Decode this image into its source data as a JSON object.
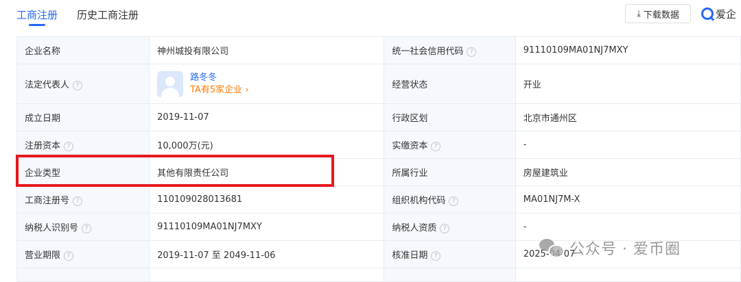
{
  "tabs": [
    {
      "label": "工商注册",
      "active": true
    },
    {
      "label": "历史工商注册",
      "active": false
    }
  ],
  "toolbar": {
    "download_icon": "download-icon",
    "download_label": "下载数据",
    "brand_label": "爱企"
  },
  "table": {
    "rows": [
      {
        "l1": "企业名称",
        "v1": "神州城投有限公司",
        "l2": "统一社会信用代码",
        "v2": "91110109MA01NJ7MXY"
      },
      {
        "l1": "法定代表人",
        "rep_name": "路冬冬",
        "rep_link": "TA有5家企业",
        "l2": "经营状态",
        "v2": "开业"
      },
      {
        "l1": "成立日期",
        "v1": "2019-11-07",
        "l2": "行政区划",
        "v2": "北京市通州区"
      },
      {
        "l1": "注册资本",
        "v1": "10,000万(元)",
        "l2": "实缴资本",
        "v2": "-"
      },
      {
        "l1": "企业类型",
        "v1": "其他有限责任公司",
        "l2": "所属行业",
        "v2": "房屋建筑业"
      },
      {
        "l1": "工商注册号",
        "v1": "110109028013681",
        "l2": "组织机构代码",
        "v2": "MA01NJ7M-X"
      },
      {
        "l1": "纳税人识别号",
        "v1": "91110109MA01NJ7MXY",
        "l2": "纳税人资质",
        "v2": "-"
      },
      {
        "l1": "营业期限",
        "v1": "2019-11-07 至 2049-11-06",
        "l2": "核准日期",
        "v2": "2025-04-07"
      }
    ]
  },
  "watermark": {
    "text": "公众号 · 爱币圈"
  },
  "colors": {
    "accent": "#2468f2",
    "link_orange": "#ff7a00",
    "highlight_red": "#e5191d",
    "label_bg": "#f5f8fc",
    "border": "#e8ebf0"
  }
}
